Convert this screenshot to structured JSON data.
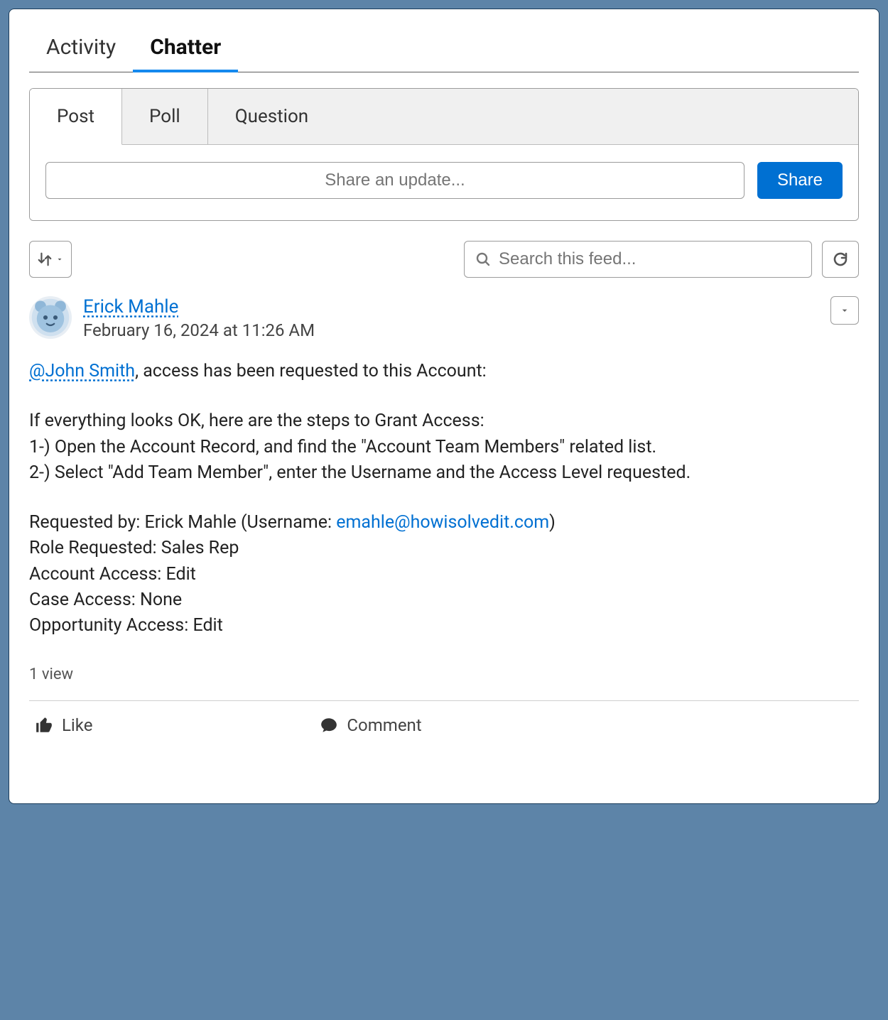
{
  "top_tabs": {
    "activity": "Activity",
    "chatter": "Chatter"
  },
  "composer": {
    "tabs": {
      "post": "Post",
      "poll": "Poll",
      "question": "Question"
    },
    "placeholder": "Share an update...",
    "share_label": "Share"
  },
  "toolbar": {
    "search_placeholder": "Search this feed..."
  },
  "feed": {
    "author": "Erick Mahle",
    "timestamp": "February 16, 2024 at 11:26 AM",
    "mention": "@John Smith",
    "line_intro_tail": ", access has been requested to this Account:",
    "steps_intro": "If everything looks OK, here are the steps to Grant Access:",
    "step1": "1-) Open the Account Record, and find the \"Account Team Members\" related list.",
    "step2": "2-) Select \"Add Team Member\", enter the Username and the Access Level requested.",
    "requested_by_prefix": "Requested by: Erick Mahle (Username: ",
    "requested_by_email": "emahle@howisolvedit.com",
    "requested_by_suffix": ")",
    "role": "Role Requested: Sales Rep",
    "account_access": "Account Access: Edit",
    "case_access": "Case Access: None",
    "opportunity_access": "Opportunity Access: Edit",
    "views": "1 view"
  },
  "actions": {
    "like": "Like",
    "comment": "Comment"
  }
}
